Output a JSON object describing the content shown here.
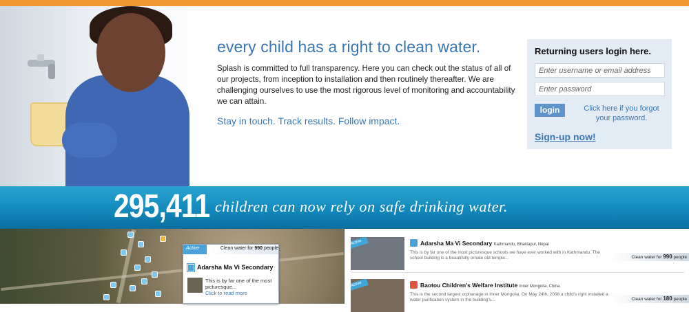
{
  "headline": "every child has a right to clean water.",
  "intro": "Splash is committed to full transparency. Here you can check out the status of all of our projects, from inception to installation and then routinely thereafter. We are challenging ourselves to use the most rigorous level of monitoring and accountability we can attain.",
  "tagline": "Stay in touch. Track results. Follow impact.",
  "login": {
    "title": "Returning users login here.",
    "username_placeholder": "Enter username or email address",
    "password_placeholder": "Enter password",
    "button_label": "login",
    "forgot_text": "Click here if you forgot your password.",
    "signup_text": "Sign-up now!"
  },
  "banner": {
    "count": "295,411",
    "text": "children can now rely on safe drinking water."
  },
  "map_popup": {
    "badge": "Active",
    "header_prefix": "Clean water for ",
    "header_count": "990",
    "header_suffix": " people",
    "title": "Adarsha Ma Vi Secondary",
    "desc": "This is by far one of the most picturesque...",
    "more": "Click to read more"
  },
  "projects": [
    {
      "badge": "Active",
      "title": "Adarsha Ma Vi Secondary",
      "location": "Kathmandu, Bhaktapur, Nepal",
      "desc": "This is by far one of the most picturesque schools we have ever worked with in Kathmandu. The school building is a beautifully ornate old temple...",
      "tag_prefix": "Clean water for ",
      "tag_count": "990",
      "tag_suffix": " people",
      "icon_color": "#4aa3d8"
    },
    {
      "badge": "Active",
      "title": "Baotou Children's Welfare Institute",
      "location": "Inner Mongolia, China",
      "desc": "This is the second largest orphanage in Inner Mongolia. On May 24th, 2008 a child's right installed a water purification system in the building's...",
      "tag_prefix": "Clean water for ",
      "tag_count": "180",
      "tag_suffix": " people",
      "icon_color": "#e0533c"
    }
  ],
  "colors": {
    "accent_orange": "#f0982e",
    "link_blue": "#3a77b2",
    "banner_blue": "#1389bd",
    "login_bg": "#e3ebf5"
  }
}
